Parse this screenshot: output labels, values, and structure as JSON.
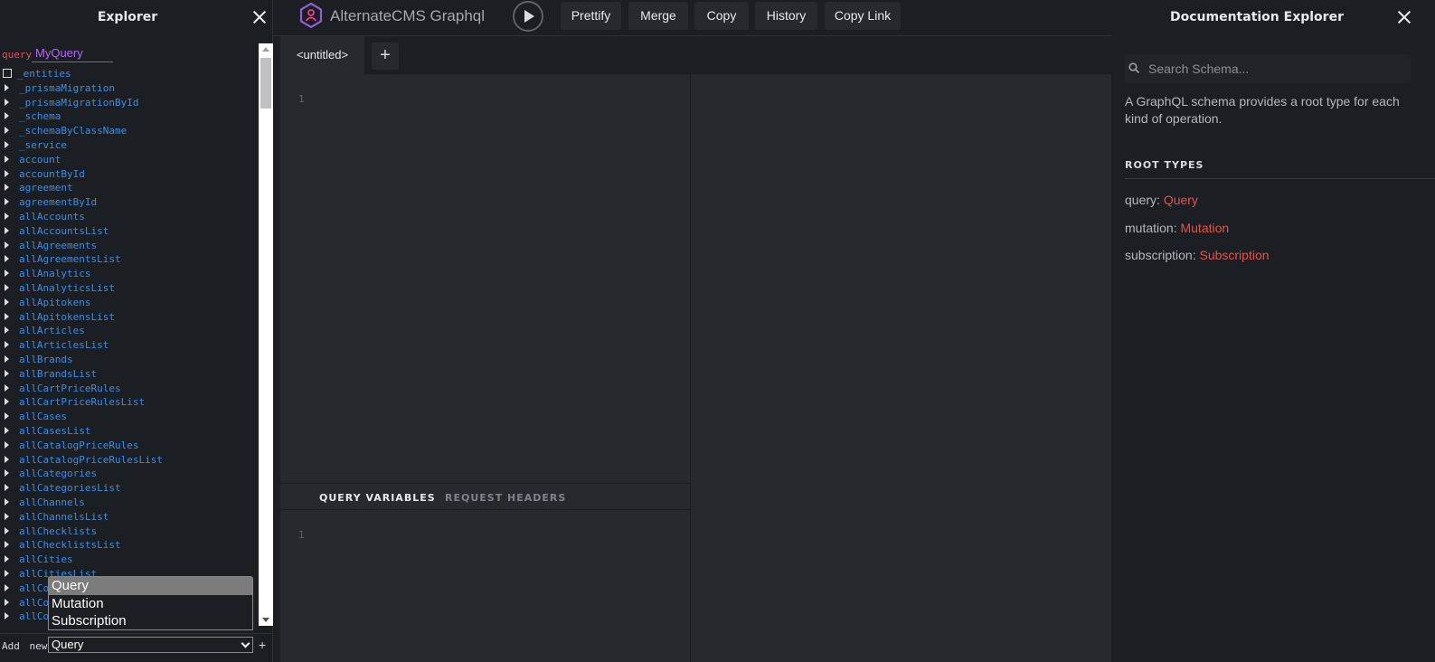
{
  "explorer": {
    "title": "Explorer",
    "query_keyword": "query",
    "query_name": "MyQuery",
    "first_entity": "_entities",
    "entities": [
      "_prismaMigration",
      "_prismaMigrationById",
      "_schema",
      "_schemaByClassName",
      "_service",
      "account",
      "accountById",
      "agreement",
      "agreementById",
      "allAccounts",
      "allAccountsList",
      "allAgreements",
      "allAgreementsList",
      "allAnalytics",
      "allAnalyticsList",
      "allApitokens",
      "allApitokensList",
      "allArticles",
      "allArticlesList",
      "allBrands",
      "allBrandsList",
      "allCartPriceRules",
      "allCartPriceRulesList",
      "allCases",
      "allCasesList",
      "allCatalogPriceRules",
      "allCatalogPriceRulesList",
      "allCategories",
      "allCategoriesList",
      "allChannels",
      "allChannelsList",
      "allChecklists",
      "allChecklistsList",
      "allCities",
      "allCitiesList",
      "allCo",
      "allCo",
      "allCo"
    ],
    "operation_options": [
      "Query",
      "Mutation",
      "Subscription"
    ],
    "add_new_label": "Add new",
    "add_new_value": "Query",
    "add_plus": "+"
  },
  "toolbar": {
    "app_title": "AlternateCMS Graphql",
    "buttons": [
      "Prettify",
      "Merge",
      "Copy",
      "History",
      "Copy Link"
    ]
  },
  "editor": {
    "tab_label": "<untitled>",
    "tab_add": "+",
    "query_line": "1",
    "vars_tabs": [
      "QUERY VARIABLES",
      "REQUEST HEADERS"
    ],
    "vars_line": "1"
  },
  "docs": {
    "title": "Documentation Explorer",
    "search_placeholder": "Search Schema...",
    "description": "A GraphQL schema provides a root type for each kind of operation.",
    "root_types_title": "ROOT TYPES",
    "root_types": [
      {
        "label": "query: ",
        "type": "Query"
      },
      {
        "label": "mutation: ",
        "type": "Mutation"
      },
      {
        "label": "subscription: ",
        "type": "Subscription"
      }
    ]
  },
  "colors": {
    "background": "#1b1e22",
    "panel": "#262a2f",
    "link_blue": "#3d8ee6",
    "type_red": "#e5534b",
    "query_name_purple": "#b36bf0"
  }
}
